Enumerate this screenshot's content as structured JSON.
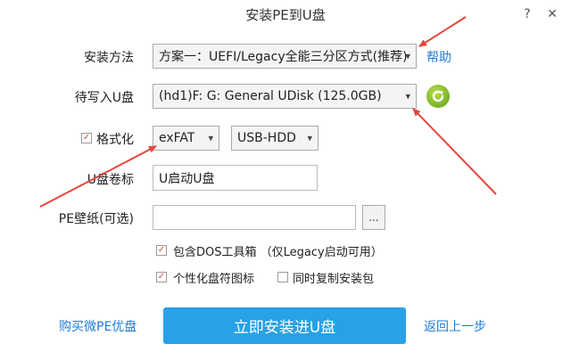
{
  "window": {
    "title": "安装PE到U盘",
    "help_glyph": "?",
    "close_glyph": "✕"
  },
  "install_method": {
    "label": "安装方法",
    "value": "方案一：UEFI/Legacy全能三分区方式(推荐)",
    "help_link": "帮助"
  },
  "target_disk": {
    "label": "待写入U盘",
    "value": "(hd1)F: G: General UDisk (125.0GB)"
  },
  "format": {
    "label": "格式化",
    "checked": true,
    "filesystem": "exFAT",
    "mode": "USB-HDD"
  },
  "volume_label": {
    "label": "U盘卷标",
    "value": "U启动U盘"
  },
  "wallpaper": {
    "label": "PE壁纸(可选)",
    "value": "",
    "browse_label": "..."
  },
  "options": [
    {
      "label": "包含DOS工具箱 （仅Legacy启动可用）",
      "checked": true
    },
    {
      "label": "个性化盘符图标",
      "checked": true
    },
    {
      "label": "同时复制安装包",
      "checked": false
    }
  ],
  "footer": {
    "buy_link": "购买微PE优盘",
    "install_button": "立即安装进U盘",
    "back_link": "返回上一步"
  },
  "colors": {
    "accent": "#29a1e6",
    "link": "#1f7bd8",
    "check": "#e24d2a",
    "arrow": "#e5463d"
  }
}
